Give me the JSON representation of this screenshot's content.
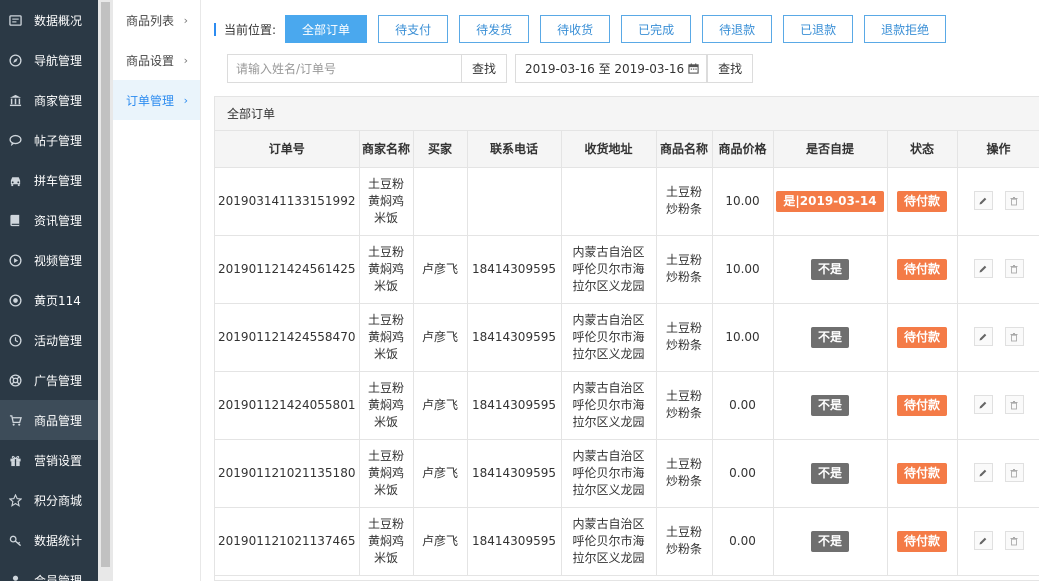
{
  "sidebar": {
    "items": [
      {
        "label": "数据概况",
        "icon": "dashboard-icon",
        "active": false
      },
      {
        "label": "导航管理",
        "icon": "compass-icon",
        "active": false
      },
      {
        "label": "商家管理",
        "icon": "bank-icon",
        "active": false
      },
      {
        "label": "帖子管理",
        "icon": "comment-icon",
        "active": false
      },
      {
        "label": "拼车管理",
        "icon": "car-icon",
        "active": false
      },
      {
        "label": "资讯管理",
        "icon": "book-icon",
        "active": false
      },
      {
        "label": "视频管理",
        "icon": "play-circle-icon",
        "active": false
      },
      {
        "label": "黄页114",
        "icon": "target-icon",
        "active": false
      },
      {
        "label": "活动管理",
        "icon": "clock-icon",
        "active": false
      },
      {
        "label": "广告管理",
        "icon": "lifebuoy-icon",
        "active": false
      },
      {
        "label": "商品管理",
        "icon": "cart-icon",
        "active": true
      },
      {
        "label": "营销设置",
        "icon": "gift-icon",
        "active": false
      },
      {
        "label": "积分商城",
        "icon": "star-icon",
        "active": false
      },
      {
        "label": "数据统计",
        "icon": "key-icon",
        "active": false
      },
      {
        "label": "会员管理",
        "icon": "user-icon",
        "active": false
      }
    ]
  },
  "subnav": {
    "items": [
      {
        "label": "商品列表",
        "active": false
      },
      {
        "label": "商品设置",
        "active": false
      },
      {
        "label": "订单管理",
        "active": true
      }
    ]
  },
  "breadcrumb": {
    "label": "当前位置:",
    "tabs": [
      {
        "label": "全部订单",
        "active": true
      },
      {
        "label": "待支付",
        "active": false
      },
      {
        "label": "待发货",
        "active": false
      },
      {
        "label": "待收货",
        "active": false
      },
      {
        "label": "已完成",
        "active": false
      },
      {
        "label": "待退款",
        "active": false
      },
      {
        "label": "已退款",
        "active": false
      },
      {
        "label": "退款拒绝",
        "active": false
      }
    ]
  },
  "search": {
    "placeholder": "请输入姓名/订单号",
    "value": "",
    "button": "查找",
    "date_range": "2019-03-16 至 2019-03-16",
    "date_button": "查找"
  },
  "panel": {
    "title": "全部订单"
  },
  "table": {
    "headers": [
      "订单号",
      "商家名称",
      "买家",
      "联系电话",
      "收货地址",
      "商品名称",
      "商品价格",
      "是否自提",
      "状态",
      "操作"
    ],
    "rows": [
      {
        "order_no": "201903141133151992",
        "merchant": "土豆粉黄焖鸡米饭",
        "buyer": "",
        "phone": "",
        "address": "",
        "product": "土豆粉炒粉条",
        "price": "10.00",
        "pickup": "是|2019-03-14",
        "pickup_type": "orange",
        "status": "待付款"
      },
      {
        "order_no": "201901121424561425",
        "merchant": "土豆粉黄焖鸡米饭",
        "buyer": "卢彦飞",
        "phone": "18414309595",
        "address": "内蒙古自治区呼伦贝尔市海拉尔区义龙园",
        "product": "土豆粉炒粉条",
        "price": "10.00",
        "pickup": "不是",
        "pickup_type": "gray",
        "status": "待付款"
      },
      {
        "order_no": "201901121424558470",
        "merchant": "土豆粉黄焖鸡米饭",
        "buyer": "卢彦飞",
        "phone": "18414309595",
        "address": "内蒙古自治区呼伦贝尔市海拉尔区义龙园",
        "product": "土豆粉炒粉条",
        "price": "10.00",
        "pickup": "不是",
        "pickup_type": "gray",
        "status": "待付款"
      },
      {
        "order_no": "201901121424055801",
        "merchant": "土豆粉黄焖鸡米饭",
        "buyer": "卢彦飞",
        "phone": "18414309595",
        "address": "内蒙古自治区呼伦贝尔市海拉尔区义龙园",
        "product": "土豆粉炒粉条",
        "price": "0.00",
        "pickup": "不是",
        "pickup_type": "gray",
        "status": "待付款"
      },
      {
        "order_no": "201901121021135180",
        "merchant": "土豆粉黄焖鸡米饭",
        "buyer": "卢彦飞",
        "phone": "18414309595",
        "address": "内蒙古自治区呼伦贝尔市海拉尔区义龙园",
        "product": "土豆粉炒粉条",
        "price": "0.00",
        "pickup": "不是",
        "pickup_type": "gray",
        "status": "待付款"
      },
      {
        "order_no": "201901121021137465",
        "merchant": "土豆粉黄焖鸡米饭",
        "buyer": "卢彦飞",
        "phone": "18414309595",
        "address": "内蒙古自治区呼伦贝尔市海拉尔区义龙园",
        "product": "土豆粉炒粉条",
        "price": "0.00",
        "pickup": "不是",
        "pickup_type": "gray",
        "status": "待付款"
      }
    ]
  },
  "colors": {
    "sidebar_bg": "#2b3945",
    "accent": "#2d8cf0",
    "badge_orange": "#f47b47",
    "badge_gray": "#6f6f6f"
  }
}
